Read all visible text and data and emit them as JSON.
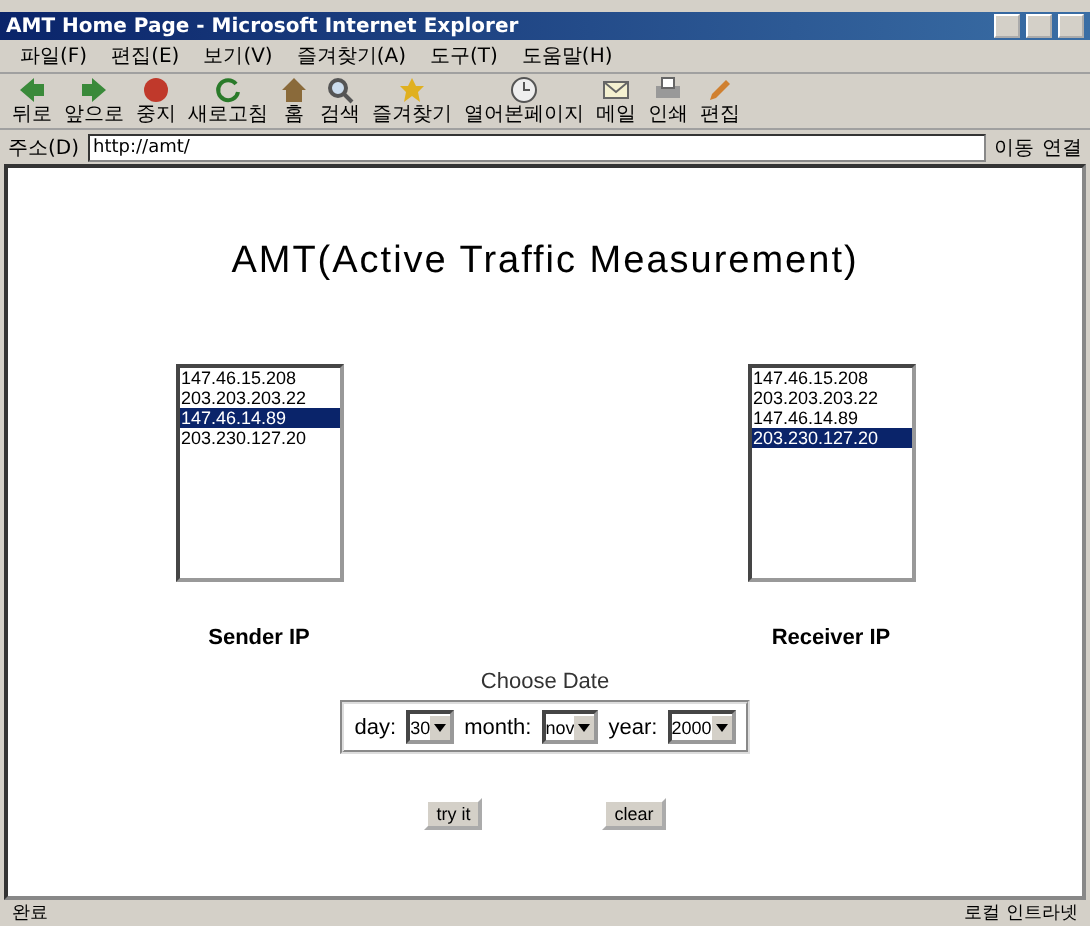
{
  "window": {
    "title": "AMT Home Page - Microsoft Internet Explorer"
  },
  "menu": [
    "파일(F)",
    "편집(E)",
    "보기(V)",
    "즐겨찾기(A)",
    "도구(T)",
    "도움말(H)"
  ],
  "toolbar": [
    {
      "label": "뒤로",
      "kind": "back"
    },
    {
      "label": "앞으로",
      "kind": "forward"
    },
    {
      "label": "중지",
      "kind": "stop"
    },
    {
      "label": "새로고침",
      "kind": "refresh"
    },
    {
      "label": "홈",
      "kind": "home"
    },
    {
      "label": "검색",
      "kind": "search"
    },
    {
      "label": "즐겨찾기",
      "kind": "favorites"
    },
    {
      "label": "열어본페이지",
      "kind": "history"
    },
    {
      "label": "메일",
      "kind": "mail"
    },
    {
      "label": "인쇄",
      "kind": "print"
    },
    {
      "label": "편집",
      "kind": "edit"
    }
  ],
  "address": {
    "label": "주소(D)",
    "value": "http://amt/",
    "go": "이동",
    "links": "연결"
  },
  "page": {
    "heading": "AMT(Active Traffic Measurement)",
    "sender": {
      "label": "Sender IP",
      "options": [
        {
          "text": "147.46.15.208",
          "selected": false
        },
        {
          "text": "203.203.203.22",
          "selected": false
        },
        {
          "text": "147.46.14.89",
          "selected": true
        },
        {
          "text": "203.230.127.20",
          "selected": false
        }
      ]
    },
    "receiver": {
      "label": "Receiver IP",
      "options": [
        {
          "text": "147.46.15.208",
          "selected": false
        },
        {
          "text": "203.203.203.22",
          "selected": false
        },
        {
          "text": "147.46.14.89",
          "selected": false
        },
        {
          "text": "203.230.127.20",
          "selected": true
        }
      ]
    },
    "date": {
      "title": "Choose Date",
      "fields": [
        {
          "label": "day:",
          "value": "30"
        },
        {
          "label": "month:",
          "value": "nov"
        },
        {
          "label": "year:",
          "value": "2000"
        }
      ]
    },
    "buttons": [
      "try it",
      "clear"
    ]
  },
  "status_bar": {
    "text": "완료",
    "zone": "로컬 인트라넷"
  }
}
